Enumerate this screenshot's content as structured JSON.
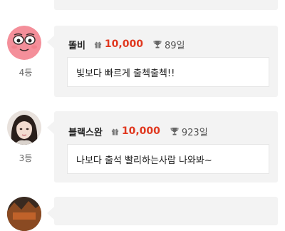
{
  "entries": [
    {
      "rank": "4등",
      "nickname": "똘비",
      "points": "10,000",
      "days": "89일",
      "message": "빛보다 빠르게 출첵출첵!!",
      "avatar": "pink-face-avatar"
    },
    {
      "rank": "3등",
      "nickname": "블랙스완",
      "points": "10,000",
      "days": "923일",
      "message": "나보다 출석 빨리하는사람 나와봐~",
      "avatar": "woman-photo-avatar"
    }
  ],
  "icons": {
    "points": "gift-icon",
    "days": "trophy-icon"
  },
  "colors": {
    "points": "#e0381f",
    "card_bg": "#f3f3f3"
  }
}
